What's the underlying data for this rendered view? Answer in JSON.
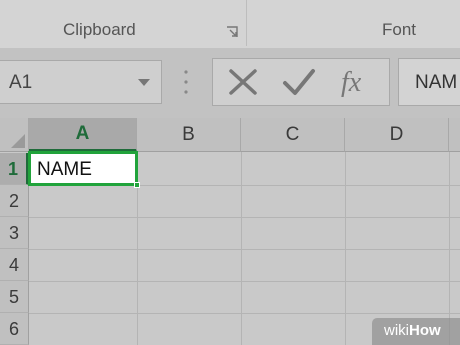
{
  "ribbon": {
    "groups": [
      "Clipboard",
      "Font"
    ]
  },
  "name_box": {
    "value": "A1"
  },
  "formula_bar": {
    "cancel_icon": "x-icon",
    "enter_icon": "check-icon",
    "insert_function_label": "fx",
    "content": "NAM"
  },
  "grid": {
    "columns": [
      "A",
      "B",
      "C",
      "D"
    ],
    "rows": [
      "1",
      "2",
      "3",
      "4",
      "5",
      "6"
    ],
    "active_cell": {
      "ref": "A1",
      "value": "NAME"
    }
  },
  "watermark": {
    "part1": "wiki",
    "part2": "How"
  },
  "colors": {
    "selection": "#21a33b",
    "header_active": "#1f6b3a"
  }
}
